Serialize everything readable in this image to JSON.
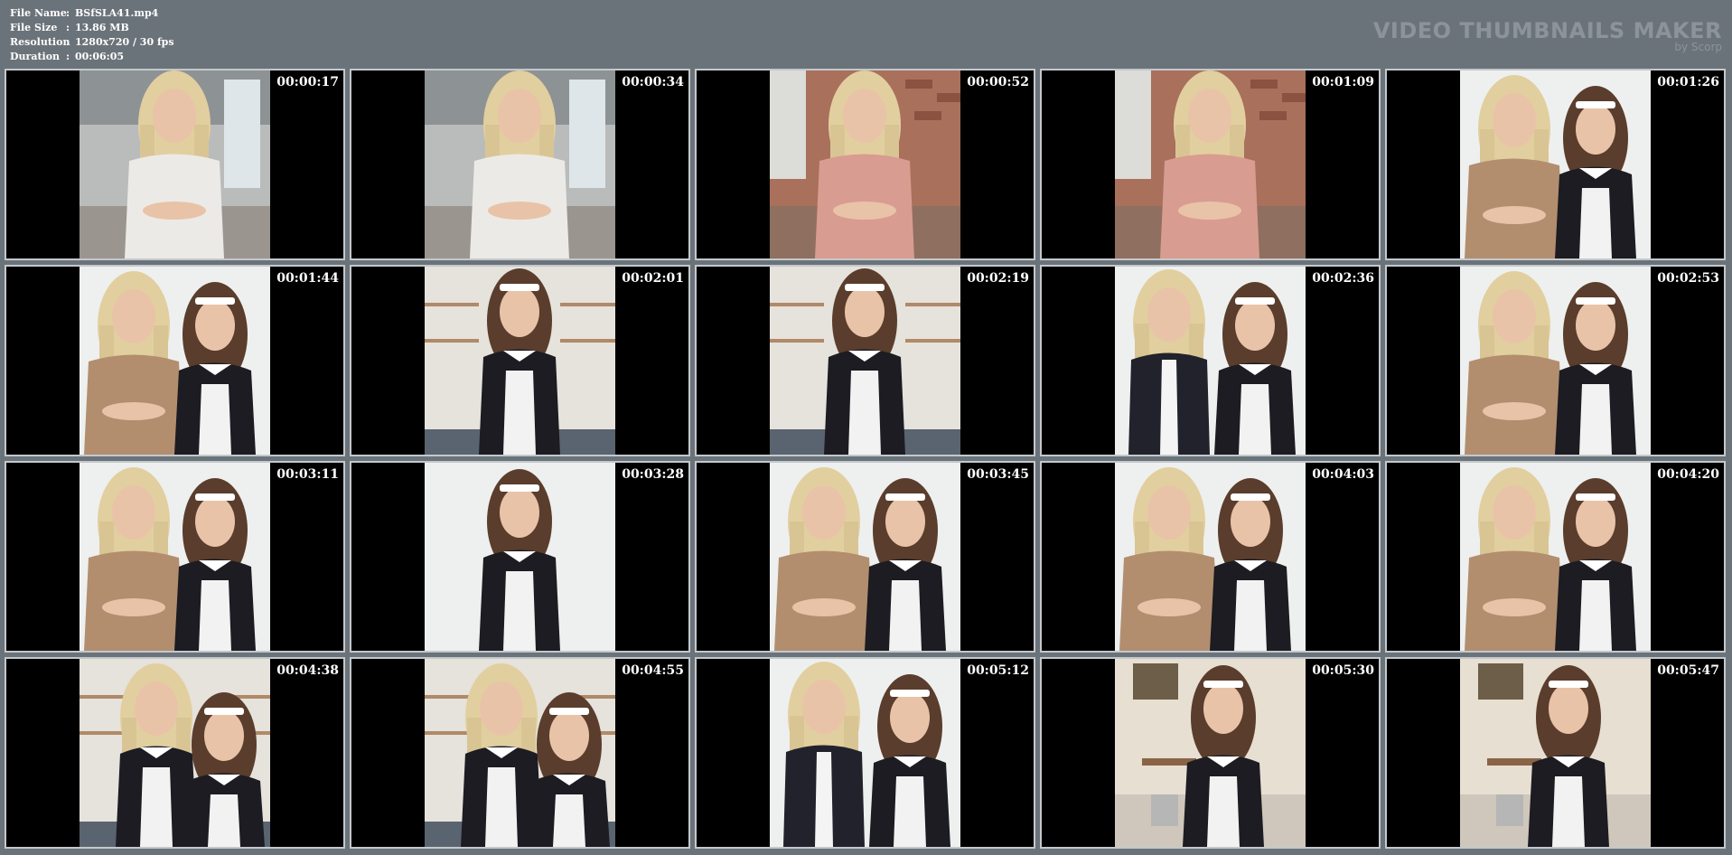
{
  "file_info": [
    {
      "label": "File Name",
      "sep": ":",
      "value": "BSfSLA41.mp4"
    },
    {
      "label": "File Size",
      "sep": ":",
      "value": "13.86 MB"
    },
    {
      "label": "Resolution",
      "sep": ":",
      "value": "1280x720 / 30 fps"
    },
    {
      "label": "Duration",
      "sep": ":",
      "value": "00:06:05"
    }
  ],
  "brand": {
    "title": "VIDEO THUMBNAILS MAKER",
    "subtitle": "by Scorp"
  },
  "thumbnails": [
    {
      "time": "00:00:17",
      "scene": "blonde-white-sweater"
    },
    {
      "time": "00:00:34",
      "scene": "blonde-white-sweater"
    },
    {
      "time": "00:00:52",
      "scene": "blonde-pink-sweater"
    },
    {
      "time": "00:01:09",
      "scene": "blonde-pink-sweater"
    },
    {
      "time": "00:01:26",
      "scene": "two-women-maid"
    },
    {
      "time": "00:01:44",
      "scene": "two-women-maid"
    },
    {
      "time": "00:02:01",
      "scene": "maid-alone"
    },
    {
      "time": "00:02:19",
      "scene": "maid-alone"
    },
    {
      "time": "00:02:36",
      "scene": "two-women-suit"
    },
    {
      "time": "00:02:53",
      "scene": "two-women-maid"
    },
    {
      "time": "00:03:11",
      "scene": "two-women-maid"
    },
    {
      "time": "00:03:28",
      "scene": "maid-white-bg"
    },
    {
      "time": "00:03:45",
      "scene": "two-women-maid"
    },
    {
      "time": "00:04:03",
      "scene": "two-women-maid"
    },
    {
      "time": "00:04:20",
      "scene": "two-women-maid"
    },
    {
      "time": "00:04:38",
      "scene": "two-maids-standing"
    },
    {
      "time": "00:04:55",
      "scene": "two-maids-standing"
    },
    {
      "time": "00:05:12",
      "scene": "two-women-suit"
    },
    {
      "time": "00:05:30",
      "scene": "maid-cleaning"
    },
    {
      "time": "00:05:47",
      "scene": "maid-cleaning"
    }
  ]
}
